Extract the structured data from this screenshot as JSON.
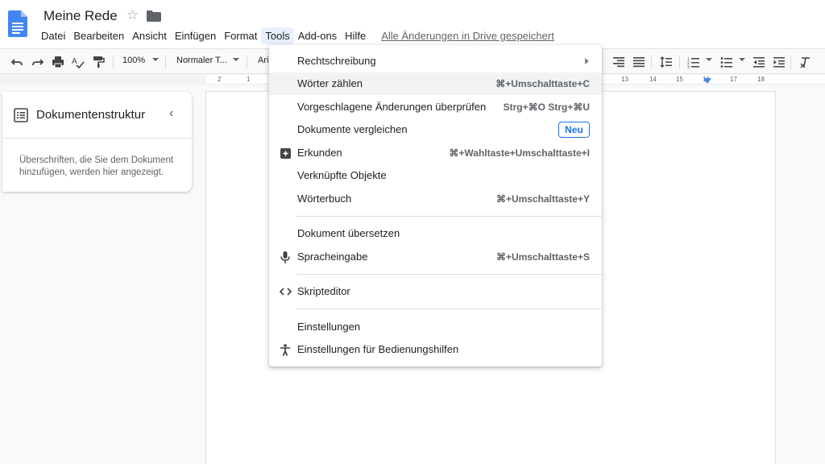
{
  "header": {
    "title": "Meine Rede",
    "menu": [
      "Datei",
      "Bearbeiten",
      "Ansicht",
      "Einfügen",
      "Format",
      "Tools",
      "Add-ons",
      "Hilfe"
    ],
    "active_menu": "Tools",
    "save_status": "Alle Änderungen in Drive gespeichert"
  },
  "toolbar": {
    "zoom": "100%",
    "style": "Normaler T...",
    "font": "Ari"
  },
  "ruler": {
    "left_numbers": [
      "2",
      "1"
    ],
    "right_numbers": [
      "13",
      "14",
      "15",
      "16",
      "17",
      "18"
    ]
  },
  "outline": {
    "title": "Dokumentenstruktur",
    "hint": "Überschriften, die Sie dem Dokument hinzufügen, werden hier angezeigt."
  },
  "tools_menu": {
    "items": [
      {
        "label": "Rechtschreibung",
        "shortcut": "",
        "submenu": true
      },
      {
        "label": "Wörter zählen",
        "shortcut": "⌘+Umschalttaste+C"
      },
      {
        "label": "Vorgeschlagene Änderungen überprüfen",
        "shortcut": "Strg+⌘O Strg+⌘U"
      },
      {
        "label": "Dokumente vergleichen",
        "badge": "Neu"
      },
      {
        "label": "Erkunden",
        "shortcut": "⌘+Wahltaste+Umschalttaste+I",
        "icon": "explore-icon"
      },
      {
        "label": "Verknüpfte Objekte",
        "shortcut": ""
      },
      {
        "label": "Wörterbuch",
        "shortcut": "⌘+Umschalttaste+Y"
      },
      {
        "label": "Dokument übersetzen",
        "shortcut": ""
      },
      {
        "label": "Spracheingabe",
        "shortcut": "⌘+Umschalttaste+S",
        "icon": "microphone-icon"
      },
      {
        "label": "Skripteditor",
        "shortcut": "",
        "icon": "code-icon"
      },
      {
        "label": "Einstellungen",
        "shortcut": ""
      },
      {
        "label": "Einstellungen für Bedienungshilfen",
        "shortcut": "",
        "icon": "accessibility-icon"
      }
    ]
  },
  "colors": {
    "accent": "#1a73e8",
    "ruler_marker": "#4285f4",
    "hover": "#f1f3f4"
  }
}
